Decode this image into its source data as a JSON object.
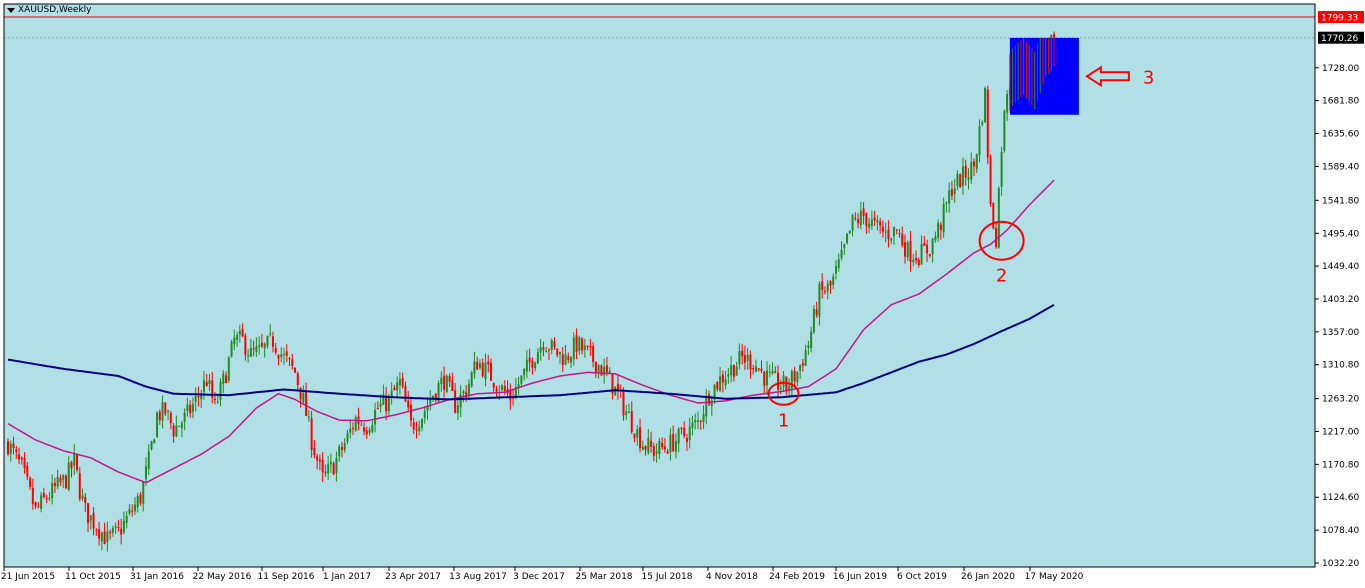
{
  "window": {
    "title": "XAUUSD,Weekly"
  },
  "colors": {
    "background": "#b0e0e6",
    "up_candle": "#228b22",
    "down_candle": "#ff0000",
    "ma_fast": "#c71585",
    "ma_slow": "#000080",
    "annotation": "#ff0000",
    "highlight_box": "#0000ff",
    "price_line_high": "#ff0000"
  },
  "chart_data": {
    "type": "candlestick",
    "symbol": "XAUUSD",
    "timeframe": "Weekly",
    "ylim": [
      1032.2,
      1799.33
    ],
    "y_ticks": [
      1032.2,
      1078.4,
      1124.6,
      1170.8,
      1217.0,
      1263.2,
      1310.8,
      1357.0,
      1403.2,
      1449.4,
      1495.4,
      1541.8,
      1589.4,
      1635.6,
      1681.8,
      1728.0
    ],
    "price_labels": {
      "high_line": "1799.33",
      "current": "1770.26",
      "high_value": 1799.33,
      "current_value": 1770.26
    },
    "x_ticks": [
      "21 Jun 2015",
      "11 Oct 2015",
      "31 Jan 2016",
      "22 May 2016",
      "11 Sep 2016",
      "1 Jan 2017",
      "23 Apr 2017",
      "13 Aug 2017",
      "3 Dec 2017",
      "25 Mar 2018",
      "15 Jul 2018",
      "4 Nov 2018",
      "24 Feb 2019",
      "16 Jun 2019",
      "6 Oct 2019",
      "26 Jan 2020",
      "17 May 2020"
    ],
    "price_path": [
      [
        0,
        1200
      ],
      [
        5,
        1165
      ],
      [
        10,
        1105
      ],
      [
        14,
        1125
      ],
      [
        18,
        1140
      ],
      [
        21,
        1150
      ],
      [
        24,
        1175
      ],
      [
        26,
        1135
      ],
      [
        28,
        1105
      ],
      [
        32,
        1085
      ],
      [
        36,
        1065
      ],
      [
        40,
        1075
      ],
      [
        44,
        1100
      ],
      [
        48,
        1125
      ],
      [
        51,
        1175
      ],
      [
        54,
        1240
      ],
      [
        57,
        1245
      ],
      [
        60,
        1220
      ],
      [
        64,
        1235
      ],
      [
        68,
        1260
      ],
      [
        72,
        1290
      ],
      [
        75,
        1250
      ],
      [
        79,
        1300
      ],
      [
        82,
        1345
      ],
      [
        85,
        1345
      ],
      [
        88,
        1325
      ],
      [
        92,
        1330
      ],
      [
        96,
        1345
      ],
      [
        100,
        1320
      ],
      [
        104,
        1300
      ],
      [
        107,
        1260
      ],
      [
        110,
        1205
      ],
      [
        114,
        1150
      ],
      [
        118,
        1170
      ],
      [
        122,
        1200
      ],
      [
        126,
        1235
      ],
      [
        130,
        1225
      ],
      [
        134,
        1250
      ],
      [
        138,
        1260
      ],
      [
        142,
        1285
      ],
      [
        146,
        1225
      ],
      [
        150,
        1240
      ],
      [
        154,
        1270
      ],
      [
        158,
        1290
      ],
      [
        162,
        1255
      ],
      [
        166,
        1275
      ],
      [
        170,
        1315
      ],
      [
        174,
        1300
      ],
      [
        178,
        1280
      ],
      [
        182,
        1265
      ],
      [
        186,
        1290
      ],
      [
        190,
        1320
      ],
      [
        194,
        1345
      ],
      [
        198,
        1330
      ],
      [
        202,
        1320
      ],
      [
        206,
        1340
      ],
      [
        210,
        1325
      ],
      [
        214,
        1310
      ],
      [
        218,
        1290
      ],
      [
        222,
        1260
      ],
      [
        226,
        1230
      ],
      [
        230,
        1200
      ],
      [
        234,
        1190
      ],
      [
        238,
        1195
      ],
      [
        242,
        1205
      ],
      [
        246,
        1215
      ],
      [
        250,
        1230
      ],
      [
        254,
        1270
      ],
      [
        258,
        1290
      ],
      [
        262,
        1305
      ],
      [
        266,
        1320
      ],
      [
        270,
        1315
      ],
      [
        274,
        1295
      ],
      [
        278,
        1285
      ],
      [
        282,
        1280
      ],
      [
        286,
        1300
      ],
      [
        290,
        1340
      ],
      [
        294,
        1410
      ],
      [
        298,
        1420
      ],
      [
        302,
        1460
      ],
      [
        306,
        1510
      ],
      [
        310,
        1520
      ],
      [
        314,
        1505
      ],
      [
        318,
        1495
      ],
      [
        322,
        1500
      ],
      [
        326,
        1470
      ],
      [
        330,
        1465
      ],
      [
        334,
        1475
      ],
      [
        338,
        1510
      ],
      [
        342,
        1560
      ],
      [
        346,
        1575
      ],
      [
        350,
        1590
      ],
      [
        352,
        1640
      ],
      [
        354,
        1690
      ],
      [
        356,
        1530
      ],
      [
        358,
        1490
      ],
      [
        360,
        1620
      ],
      [
        362,
        1700
      ],
      [
        364,
        1715
      ],
      [
        368,
        1730
      ],
      [
        372,
        1710
      ],
      [
        376,
        1755
      ],
      [
        379,
        1770
      ]
    ],
    "series": [
      {
        "name": "",
        "type": "moving-average",
        "points": [
          [
            0,
            1228
          ],
          [
            10,
            1205
          ],
          [
            20,
            1190
          ],
          [
            30,
            1180
          ],
          [
            40,
            1160
          ],
          [
            50,
            1145
          ],
          [
            60,
            1165
          ],
          [
            70,
            1185
          ],
          [
            80,
            1210
          ],
          [
            90,
            1250
          ],
          [
            98,
            1270
          ],
          [
            104,
            1262
          ],
          [
            112,
            1245
          ],
          [
            120,
            1233
          ],
          [
            130,
            1232
          ],
          [
            140,
            1240
          ],
          [
            150,
            1250
          ],
          [
            160,
            1262
          ],
          [
            170,
            1270
          ],
          [
            180,
            1272
          ],
          [
            190,
            1285
          ],
          [
            200,
            1295
          ],
          [
            210,
            1300
          ],
          [
            220,
            1298
          ],
          [
            230,
            1282
          ],
          [
            240,
            1268
          ],
          [
            250,
            1257
          ],
          [
            260,
            1260
          ],
          [
            270,
            1268
          ],
          [
            280,
            1273
          ],
          [
            290,
            1280
          ],
          [
            300,
            1305
          ],
          [
            310,
            1360
          ],
          [
            320,
            1395
          ],
          [
            330,
            1410
          ],
          [
            340,
            1438
          ],
          [
            350,
            1468
          ],
          [
            356,
            1480
          ],
          [
            362,
            1500
          ],
          [
            370,
            1535
          ],
          [
            379,
            1570
          ]
        ]
      },
      {
        "name": "",
        "type": "moving-average",
        "points": [
          [
            0,
            1318
          ],
          [
            20,
            1305
          ],
          [
            40,
            1295
          ],
          [
            50,
            1280
          ],
          [
            60,
            1270
          ],
          [
            80,
            1268
          ],
          [
            100,
            1276
          ],
          [
            120,
            1270
          ],
          [
            140,
            1265
          ],
          [
            160,
            1262
          ],
          [
            180,
            1265
          ],
          [
            200,
            1268
          ],
          [
            220,
            1275
          ],
          [
            240,
            1270
          ],
          [
            260,
            1263
          ],
          [
            280,
            1265
          ],
          [
            300,
            1272
          ],
          [
            310,
            1285
          ],
          [
            320,
            1300
          ],
          [
            330,
            1315
          ],
          [
            340,
            1325
          ],
          [
            350,
            1340
          ],
          [
            360,
            1358
          ],
          [
            370,
            1375
          ],
          [
            379,
            1395
          ]
        ]
      }
    ],
    "annotations": [
      {
        "label": "1",
        "type": "circle",
        "x": 281,
        "y": 1270
      },
      {
        "label": "2",
        "type": "circle",
        "x": 360,
        "y": 1485
      },
      {
        "label": "3",
        "type": "arrow-box",
        "x_start": 363,
        "x_end": 388,
        "y_low": 1662,
        "y_high": 1770
      }
    ]
  }
}
